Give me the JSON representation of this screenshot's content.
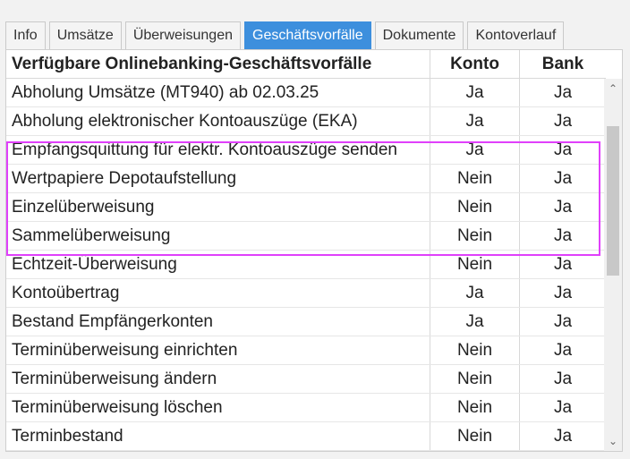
{
  "tabs": [
    {
      "label": "Info"
    },
    {
      "label": "Umsätze"
    },
    {
      "label": "Überweisungen"
    },
    {
      "label": "Geschäftsvorfälle"
    },
    {
      "label": "Dokumente"
    },
    {
      "label": "Kontoverlauf"
    }
  ],
  "active_tab": "Geschäftsvorfälle",
  "table": {
    "headers": [
      "Verfügbare Onlinebanking-Geschäftsvorfälle",
      "Konto",
      "Bank"
    ],
    "rows": [
      {
        "name": "Abholung Umsätze (MT940) ab 02.03.25",
        "konto": "Ja",
        "bank": "Ja"
      },
      {
        "name": "Abholung elektronischer Kontoauszüge (EKA)",
        "konto": "Ja",
        "bank": "Ja"
      },
      {
        "name": "Empfangsquittung für elektr. Kontoauszüge senden",
        "konto": "Ja",
        "bank": "Ja"
      },
      {
        "name": "Wertpapiere Depotaufstellung",
        "konto": "Nein",
        "bank": "Ja"
      },
      {
        "name": "Einzelüberweisung",
        "konto": "Nein",
        "bank": "Ja"
      },
      {
        "name": "Sammelüberweisung",
        "konto": "Nein",
        "bank": "Ja"
      },
      {
        "name": "Echtzeit-Überweisung",
        "konto": "Nein",
        "bank": "Ja"
      },
      {
        "name": "Kontoübertrag",
        "konto": "Ja",
        "bank": "Ja"
      },
      {
        "name": "Bestand Empfängerkonten",
        "konto": "Ja",
        "bank": "Ja"
      },
      {
        "name": "Terminüberweisung einrichten",
        "konto": "Nein",
        "bank": "Ja"
      },
      {
        "name": "Terminüberweisung ändern",
        "konto": "Nein",
        "bank": "Ja"
      },
      {
        "name": "Terminüberweisung löschen",
        "konto": "Nein",
        "bank": "Ja"
      },
      {
        "name": "Terminbestand",
        "konto": "Nein",
        "bank": "Ja"
      }
    ]
  },
  "scrollbar": {
    "position": 0.15,
    "visible_fraction": 0.45,
    "up_icon": "chevron-up-icon",
    "down_icon": "chevron-down-icon"
  },
  "highlight_rows": [
    4,
    7
  ],
  "colors": {
    "active_tab": "#3d8fdd",
    "highlight": "#e040fb"
  }
}
